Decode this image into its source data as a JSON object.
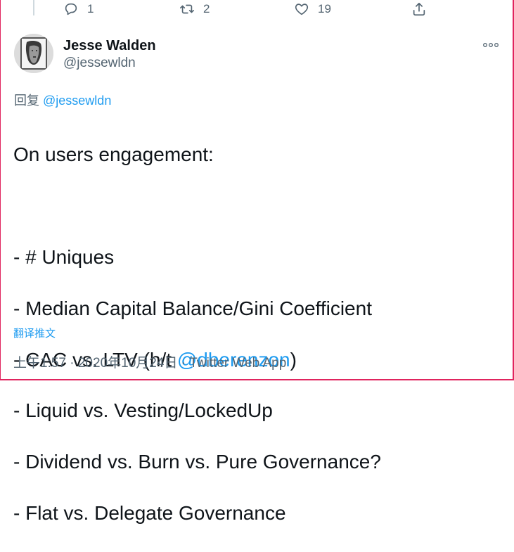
{
  "actions": {
    "reply": {
      "icon": "comment-icon",
      "count": "1"
    },
    "retweet": {
      "icon": "retweet-icon",
      "count": "2"
    },
    "like": {
      "icon": "heart-icon",
      "count": "19"
    },
    "share": {
      "icon": "share-icon"
    }
  },
  "author": {
    "name": "Jesse Walden",
    "handle": "@jessewldn",
    "avatar": "avatar-portrait"
  },
  "reply_to": {
    "prefix": "回复 ",
    "handle": "@jessewldn"
  },
  "tweet": {
    "line1": "On users engagement:",
    "line2": "- # Uniques",
    "line3": "- Median Capital Balance/Gini Coefficient",
    "line4_prefix": "- CAC vs. LTV (h/t ",
    "line4_mention": "@dberenzon",
    "line4_suffix": ")",
    "line5": "- Liquid vs. Vesting/LockedUp",
    "line6": "- Dividend vs. Burn vs. Pure Governance?",
    "line7": "- Flat vs. Delegate Governance"
  },
  "translate_label": "翻译推文",
  "meta": "上午1:57 · 2020年10月24日 · Twitter Web App",
  "colors": {
    "link": "#1d9bf0",
    "muted": "#536471",
    "frame": "#e0245e"
  }
}
